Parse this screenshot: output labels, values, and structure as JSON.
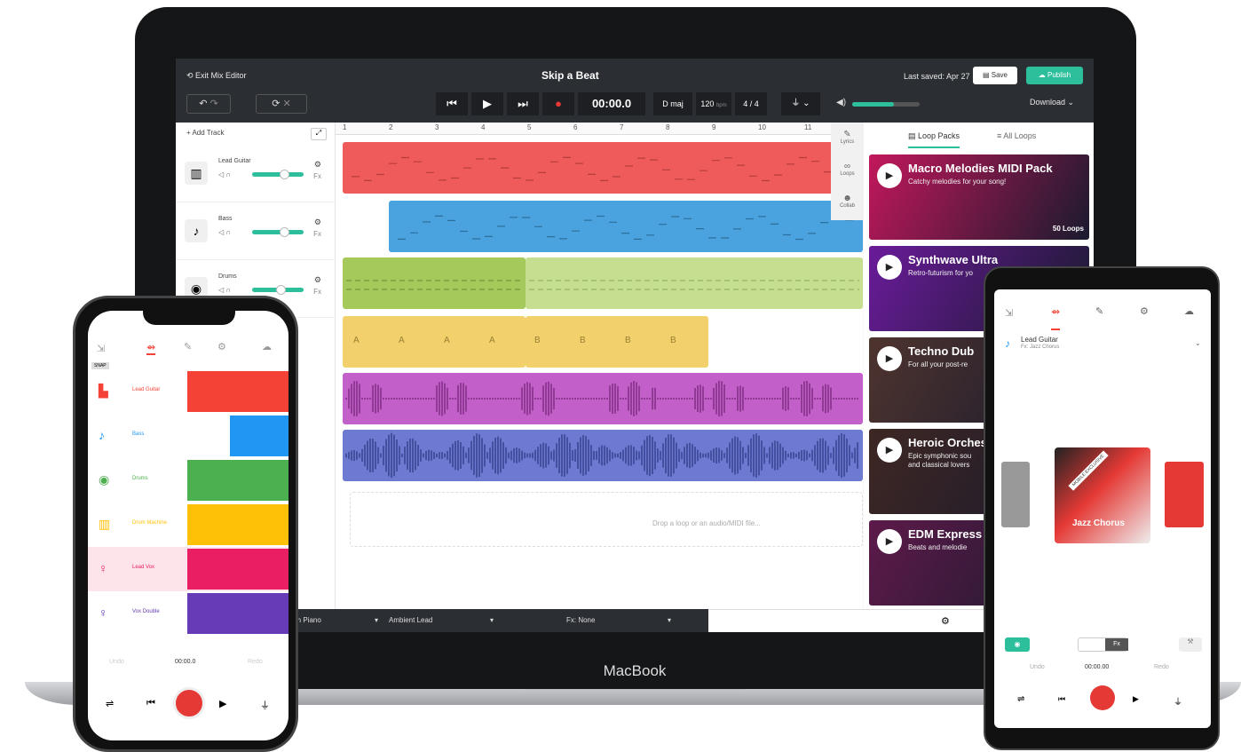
{
  "app": {
    "title": "Skip a Beat",
    "exit": "Exit Mix Editor",
    "last_saved": "Last saved: Apr 27",
    "save": "Save",
    "publish": "Publish",
    "download": "Download"
  },
  "transport": {
    "time": "00:00.0",
    "key": "D maj",
    "tempo": "120",
    "tempo_unit": "bpm",
    "meter": "4 / 4"
  },
  "track_panel": {
    "add_track": "Add Track"
  },
  "tracks": [
    {
      "name": "Lead Guitar",
      "color": "#ef5b5b",
      "fx": "Fx",
      "icon": "piano-icon",
      "glyph": "▥"
    },
    {
      "name": "Bass",
      "color": "#4aa3df",
      "fx": "Fx",
      "icon": "guitar-icon",
      "glyph": "♪"
    },
    {
      "name": "Drums",
      "color": "#a6c95c",
      "fx": "Fx",
      "icon": "drum-icon",
      "glyph": "◉"
    }
  ],
  "ruler": [
    "1",
    "2",
    "3",
    "4",
    "5",
    "6",
    "7",
    "8",
    "9",
    "10",
    "11"
  ],
  "drum_pattern": [
    "A",
    "A",
    "A",
    "A",
    "B",
    "B",
    "B",
    "B"
  ],
  "drop_hint": "Drop a loop or an audio/MIDI file...",
  "side_tabs": [
    "Lyrics",
    "Loops",
    "Collab"
  ],
  "loop_tabs": {
    "packs": "Loop Packs",
    "all": "All Loops"
  },
  "loop_packs": [
    {
      "title": "Macro Melodies MIDI Pack",
      "subtitle": "Catchy melodies for your song!",
      "count": "50 Loops",
      "bg": "#c2185b"
    },
    {
      "title": "Synthwave Ultra",
      "subtitle": "Retro-futurism for yo",
      "count": "",
      "bg": "#6a1b9a"
    },
    {
      "title": "Techno Dub",
      "subtitle": "For all your post-re",
      "count": "",
      "bg": "#4e342e"
    },
    {
      "title": "Heroic Orches",
      "subtitle": "Epic symphonic sou",
      "subtitle2": "and classical lovers",
      "count": "",
      "bg": "#3e2723"
    },
    {
      "title": "EDM Express N",
      "subtitle": "Beats and melodie",
      "count": "",
      "bg": "#5d1a4a"
    }
  ],
  "bottom_bar": {
    "instrument": "nth Piano",
    "preset": "Ambient Lead",
    "fx": "Fx: None"
  },
  "laptop_brand": "MacBook",
  "iphone": {
    "snap": "SNAP",
    "tracks": [
      {
        "name": "Lead Guitar",
        "color": "#f44336"
      },
      {
        "name": "Bass",
        "color": "#2196f3"
      },
      {
        "name": "Drums",
        "color": "#4caf50"
      },
      {
        "name": "Drum Machine",
        "color": "#ffc107"
      },
      {
        "name": "Lead Vox",
        "color": "#e91e63"
      },
      {
        "name": "Vox Double",
        "color": "#673ab7"
      }
    ],
    "undo": "Undo",
    "time": "00:00.0",
    "redo": "Redo"
  },
  "android": {
    "track": "Lead Guitar",
    "fx_line": "Fx: Jazz Chorus",
    "preset": "Jazz Chorus",
    "badge": "MOBILE EXCLUSIVE",
    "undo": "Undo",
    "time": "00:00.00",
    "redo": "Redo",
    "fx_toggle": "Fx"
  }
}
